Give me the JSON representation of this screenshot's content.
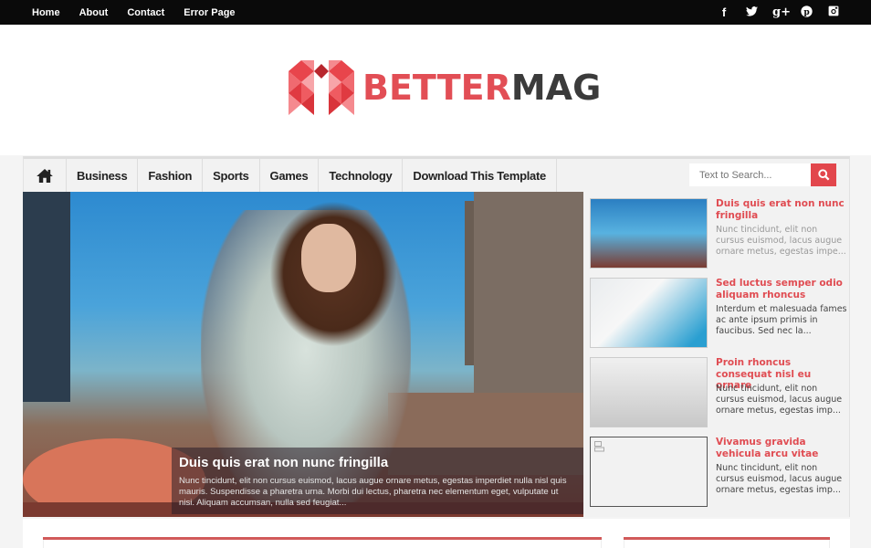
{
  "topbar": {
    "nav": [
      "Home",
      "About",
      "Contact",
      "Error Page"
    ],
    "social": [
      {
        "name": "facebook-icon",
        "glyph": "f"
      },
      {
        "name": "twitter-icon",
        "glyph": "🐦"
      },
      {
        "name": "google-plus-icon",
        "glyph": "g+"
      },
      {
        "name": "pinterest-icon",
        "glyph": "℗"
      },
      {
        "name": "instagram-icon",
        "glyph": "◙"
      }
    ]
  },
  "logo": {
    "part1": "BETTER",
    "part2": "MAG",
    "brand_color": "#e24e55",
    "dark_color": "#3b3b3b"
  },
  "nav": {
    "home_icon": "home-icon",
    "items": [
      "Business",
      "Fashion",
      "Sports",
      "Games",
      "Technology",
      "Download This Template"
    ]
  },
  "search": {
    "placeholder": "Text to Search...",
    "icon": "search-icon"
  },
  "featured": {
    "title": "Duis quis erat non nunc fringilla",
    "excerpt": "Nunc tincidunt, elit non cursus euismod, lacus augue ornare metus, egestas imperdiet nulla nisl quis mauris. Suspendisse a pharetra urna. Morbi dui lectus, pharetra nec elementum eget, vulputate ut nisi. Aliquam accumsan, nulla sed feugiat..."
  },
  "side_posts": [
    {
      "title": "Duis quis erat non nunc fringilla",
      "excerpt": "Nunc tincidunt, elit non cursus euismod, lacus augue ornare metus, egestas impe..."
    },
    {
      "title": "Sed luctus semper odio aliquam rhoncus",
      "excerpt": " Interdum et malesuada fames ac ante ipsum primis in faucibus. Sed nec la..."
    },
    {
      "title": "Proin rhoncus consequat nisl eu ornare",
      "excerpt": "Nunc tincidunt, elit non cursus euismod, lacus augue ornare metus, egestas imp..."
    },
    {
      "title": "Vivamus gravida vehicula arcu vitae",
      "excerpt": "Nunc tincidunt, elit non cursus euismod, lacus augue ornare metus, egestas imp..."
    }
  ]
}
